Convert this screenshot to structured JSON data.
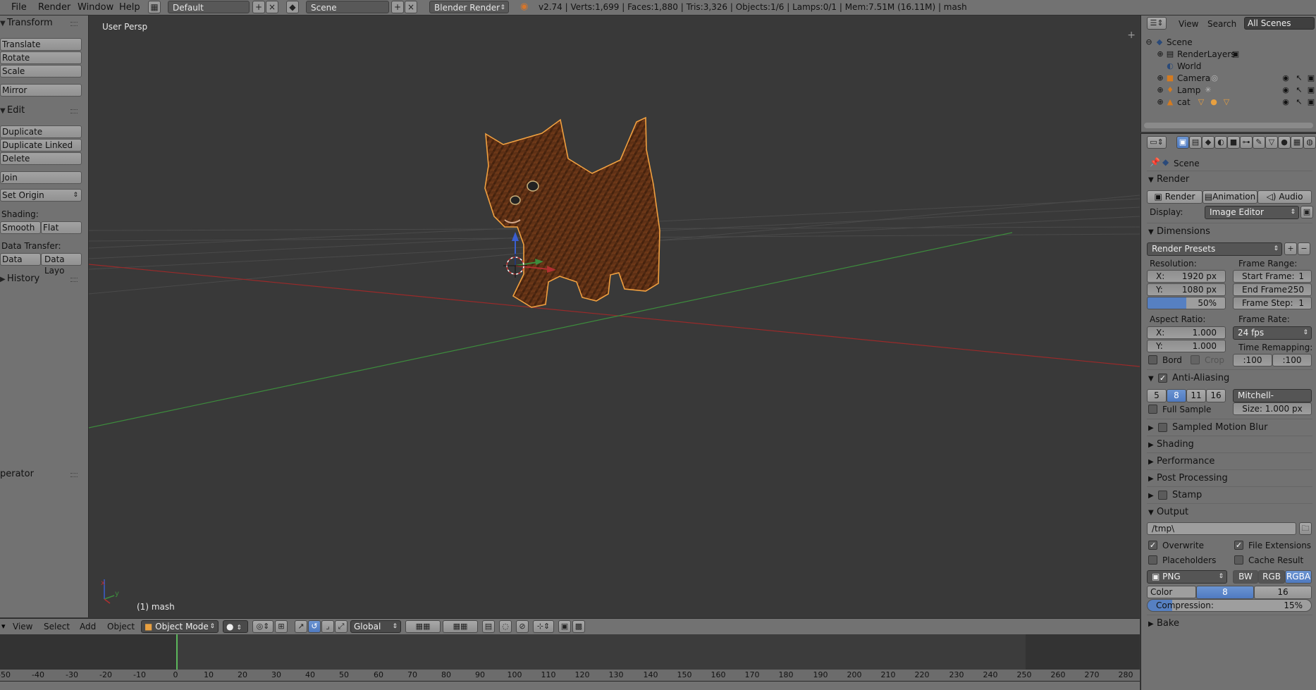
{
  "topbar": {
    "menus": [
      "File",
      "Render",
      "Window",
      "Help"
    ],
    "screen_layout": "Default",
    "scene": "Scene",
    "engine": "Blender Render",
    "stats": "v2.74 | Verts:1,699 | Faces:1,880 | Tris:3,326 | Objects:1/6 | Lamps:0/1 | Mem:7.51M (16.11M) | mash"
  },
  "toolshelf": {
    "transform_header": "Transform",
    "translate": "Translate",
    "rotate": "Rotate",
    "scale": "Scale",
    "mirror": "Mirror",
    "edit_header": "Edit",
    "duplicate": "Duplicate",
    "duplicate_linked": "Duplicate Linked",
    "delete": "Delete",
    "join": "Join",
    "set_origin": "Set Origin",
    "shading_label": "Shading:",
    "smooth": "Smooth",
    "flat": "Flat",
    "data_transfer_label": "Data Transfer:",
    "data": "Data",
    "data_layout": "Data Layo",
    "history_header": "History",
    "operator_header": "perator"
  },
  "viewport": {
    "view_name": "User Persp",
    "object_label": "(1) mash",
    "axis_x": "x",
    "axis_y": "y"
  },
  "vp_header": {
    "menus": [
      "View",
      "Select",
      "Add",
      "Object"
    ],
    "mode": "Object Mode",
    "orientation": "Global"
  },
  "timeline": {
    "ticks": [
      "-50",
      "-40",
      "-30",
      "-20",
      "-10",
      "0",
      "10",
      "20",
      "30",
      "40",
      "50",
      "60",
      "70",
      "80",
      "90",
      "100",
      "110",
      "120",
      "130",
      "140",
      "150",
      "160",
      "170",
      "180",
      "190",
      "200",
      "210",
      "220",
      "230",
      "240",
      "250",
      "260",
      "270",
      "280"
    ],
    "current_frame": "0"
  },
  "outliner": {
    "view": "View",
    "search": "Search",
    "display": "All Scenes",
    "rows": {
      "scene": "Scene",
      "render_layers": "RenderLayers",
      "world": "World",
      "camera": "Camera",
      "lamp": "Lamp",
      "cat": "cat"
    }
  },
  "properties": {
    "context": "Scene",
    "render_header": "Render",
    "render_btn": "Render",
    "animation_btn": "Animation",
    "audio_btn": "Audio",
    "display_label": "Display:",
    "display_value": "Image Editor",
    "dimensions_header": "Dimensions",
    "render_presets": "Render Presets",
    "resolution_label": "Resolution:",
    "res_x_label": "X:",
    "res_x": "1920 px",
    "res_y_label": "Y:",
    "res_y": "1080 px",
    "res_pct": "50%",
    "frame_range_label": "Frame Range:",
    "start_frame_label": "Start Frame:",
    "start_frame": "1",
    "end_frame_label": "End Frame:",
    "end_frame": "250",
    "frame_step_label": "Frame Step:",
    "frame_step": "1",
    "aspect_label": "Aspect Ratio:",
    "aspect_x_label": "X:",
    "aspect_x": "1.000",
    "aspect_y_label": "Y:",
    "aspect_y": "1.000",
    "frame_rate_label": "Frame Rate:",
    "frame_rate": "24 fps",
    "time_remap_label": "Time Remapping:",
    "remap_old": ":100",
    "remap_new": ":100",
    "bord": "Bord",
    "crop": "Crop",
    "aa_header": "Anti-Aliasing",
    "aa_5": "5",
    "aa_8": "8",
    "aa_11": "11",
    "aa_16": "16",
    "aa_filter": "Mitchell-Netravali",
    "full_sample": "Full Sample",
    "aa_size": "Size:  1.000 px",
    "motion_blur_header": "Sampled Motion Blur",
    "shading_header": "Shading",
    "performance_header": "Performance",
    "post_processing_header": "Post Processing",
    "stamp_header": "Stamp",
    "output_header": "Output",
    "output_path": "/tmp\\",
    "overwrite": "Overwrite",
    "file_extensions": "File Extensions",
    "placeholders": "Placeholders",
    "cache_result": "Cache Result",
    "file_format": "PNG",
    "bw": "BW",
    "rgb": "RGB",
    "rgba": "RGBA",
    "color_depth_label": "Color Depth:",
    "depth_8": "8",
    "depth_16": "16",
    "compression_label": "Compression:",
    "compression_value": "15%",
    "bake_header": "Bake"
  },
  "colors": {
    "panel": "#727272",
    "viewport": "#393939",
    "selection_outline": "#f0a040",
    "x_axis": "#b03030",
    "y_axis": "#3d8c3d",
    "z_axis": "#3a5ed0",
    "accent_blue": "#5680c2"
  }
}
